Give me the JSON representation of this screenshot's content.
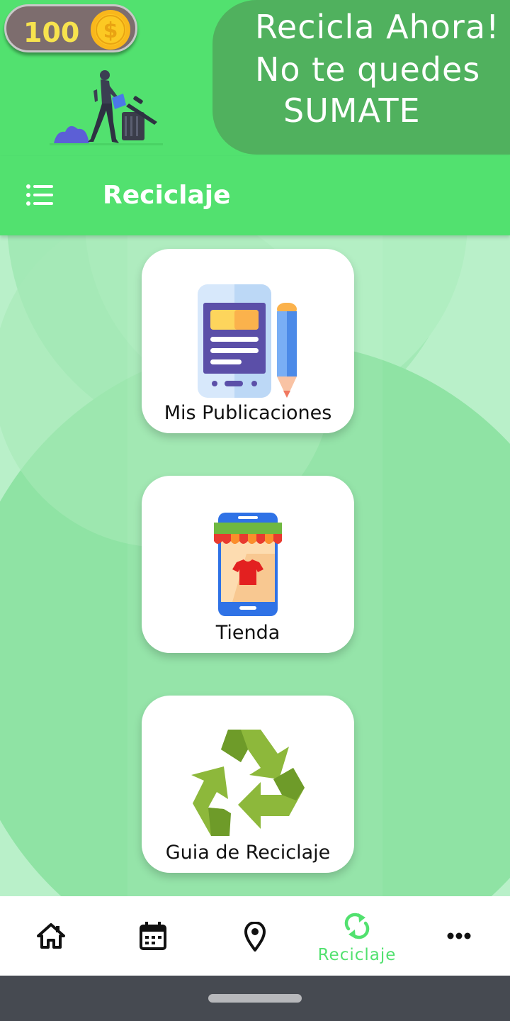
{
  "header": {
    "coins": "100",
    "coin_icon": "dollar-coin-icon",
    "slogan": [
      "Recicla Ahora!",
      "No te quedes",
      "SUMATE"
    ]
  },
  "appbar": {
    "menu_icon": "list-menu-icon",
    "title": "Reciclaje"
  },
  "cards": [
    {
      "label": "Mis Publicaciones",
      "icon": "phone-document-pencil-icon"
    },
    {
      "label": "Tienda",
      "icon": "mobile-store-icon"
    },
    {
      "label": "Guia de Reciclaje",
      "icon": "recycle-icon"
    }
  ],
  "bottom_nav": {
    "items": [
      {
        "icon": "home-icon",
        "label": ""
      },
      {
        "icon": "calendar-icon",
        "label": ""
      },
      {
        "icon": "map-pin-icon",
        "label": ""
      },
      {
        "icon": "recycle-sync-icon",
        "label": "Reciclaje",
        "active": true
      },
      {
        "icon": "more-dots-icon",
        "label": ""
      }
    ]
  },
  "colors": {
    "primary_green": "#52e16f",
    "dark_green": "#50b15e",
    "background_mint": "#b9f0c9",
    "coin_text": "#f7e34e",
    "system_bar": "#464a51"
  }
}
